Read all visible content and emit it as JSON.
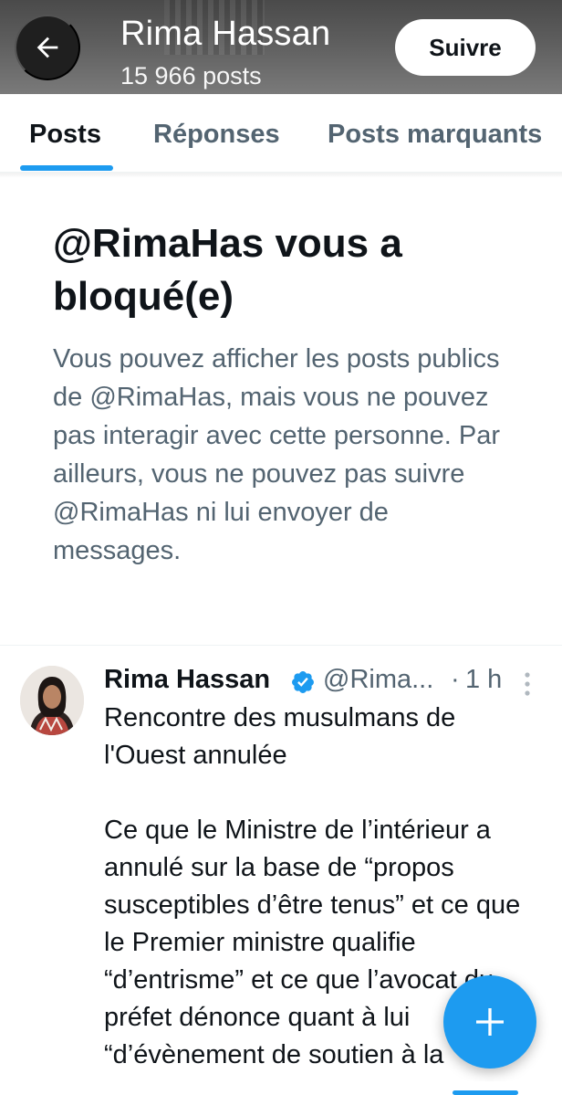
{
  "header": {
    "name": "Rima Hassan",
    "posts_count": "15 966 posts",
    "follow_label": "Suivre"
  },
  "tabs": [
    {
      "label": "Posts",
      "active": true
    },
    {
      "label": "Réponses",
      "active": false
    },
    {
      "label": "Posts marquants",
      "active": false
    }
  ],
  "blocked": {
    "title": "@RimaHas vous a bloqué(e)",
    "text": "Vous pouvez afficher les posts publics de @RimaHas, mais vous ne pouvez pas interagir avec cette personne. Par ailleurs, vous ne pouvez pas suivre @RimaHas ni lui envoyer de messages."
  },
  "post": {
    "author": "Rima Hassan",
    "handle": "@Rima...",
    "dot": "·",
    "time": "1 h",
    "paragraph1": "Rencontre des musulmans de l'Ouest annulée",
    "paragraph2": "Ce que le Ministre de l’intérieur a annulé sur la base de “propos susceptibles d’être tenus” et ce que le Premier ministre qualifie “d’entrisme” et ce que l’avocat du préfet dénonce quant à lui “d’évènement de soutien à la"
  },
  "colors": {
    "accent": "#1d9bf0",
    "text_primary": "#0f1419",
    "text_secondary": "#536471"
  },
  "icons": {
    "back": "arrow-left-icon",
    "verified": "verified-badge-icon",
    "more": "more-vertical-icon",
    "fab": "plus-icon"
  }
}
